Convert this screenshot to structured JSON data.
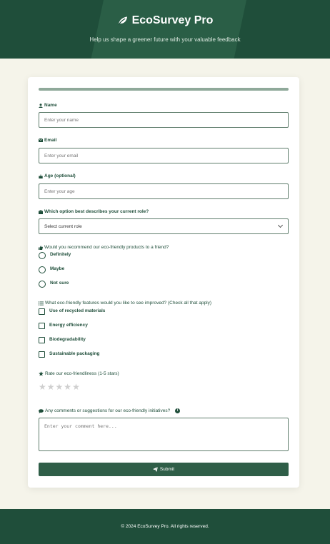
{
  "header": {
    "title": "EcoSurvey Pro",
    "subtitle": "Help us shape a greener future with your valuable feedback"
  },
  "progress": {
    "fraction": 1.0
  },
  "form": {
    "name_label": "Name",
    "name_placeholder": "Enter your name",
    "email_label": "Email",
    "email_placeholder": "Enter your email",
    "age_label": "Age (optional)",
    "age_placeholder": "Enter your age",
    "role_label": "Which option best describes your current role?",
    "role_selected": "Select current role",
    "recommend_label": "Would you recommend our eco-friendly products to a friend?",
    "recommend_options": [
      "Definitely",
      "Maybe",
      "Not sure"
    ],
    "features_label": "What eco-friendly features would you like to see improved? (Check all that apply)",
    "features_options": [
      "Use of recycled materials",
      "Energy efficiency",
      "Biodegradability",
      "Sustainable packaging"
    ],
    "rating_label": "Rate our eco-friendliness (1-5 stars)",
    "rating_value": 0,
    "rating_max": 5,
    "comments_label": "Any comments or suggestions for our eco-friendly initiatives?",
    "comments_placeholder": "Enter your comment here...",
    "submit_label": "Submit"
  },
  "footer": {
    "text": "© 2024 EcoSurvey Pro. All rights reserved."
  },
  "colors": {
    "primary": "#1f4e3a",
    "button": "#2f5e48",
    "background": "#f5f4ea",
    "star_empty": "#cfcfcf"
  }
}
